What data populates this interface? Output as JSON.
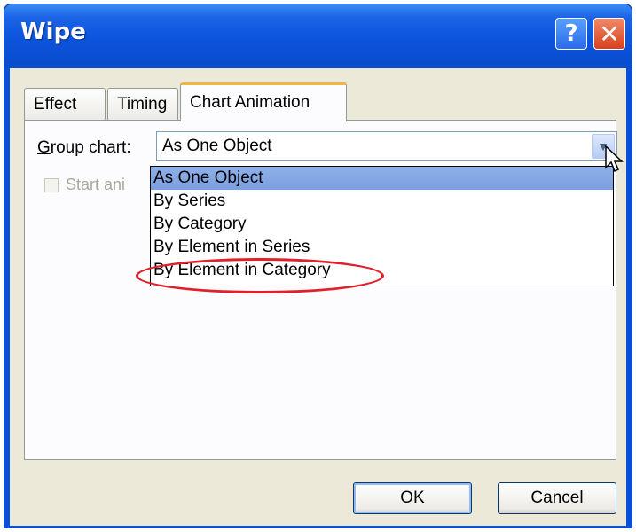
{
  "window": {
    "title": "Wipe",
    "help_label": "?",
    "close_label": "✕"
  },
  "tabs": [
    {
      "label": "Effect"
    },
    {
      "label": "Timing"
    },
    {
      "label": "Chart Animation"
    }
  ],
  "group_chart": {
    "label_underline": "G",
    "label_rest": "roup chart:",
    "value": "As One Object"
  },
  "start_checkbox": {
    "label": "Start ani"
  },
  "dropdown": {
    "options": [
      {
        "label": "As One Object"
      },
      {
        "label": "By Series"
      },
      {
        "label": "By Category"
      },
      {
        "label": "By Element in Series"
      },
      {
        "label": "By Element in Category"
      }
    ],
    "selected": "As One Object"
  },
  "buttons": {
    "ok": "OK",
    "cancel": "Cancel"
  },
  "colors": {
    "highlight": "#e0202a",
    "titlebar": "#0b54dc"
  }
}
